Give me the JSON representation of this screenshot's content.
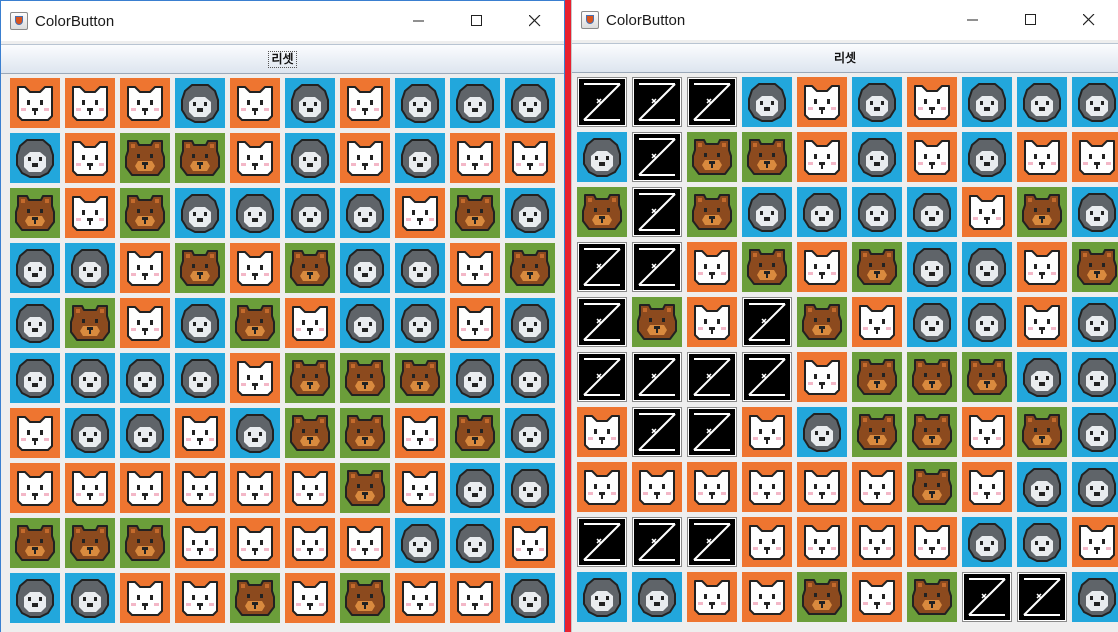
{
  "windows": [
    {
      "id": "left",
      "title": "ColorButton",
      "reset_label": "리셋",
      "grid": [
        [
          "cat",
          "cat",
          "cat",
          "penguin",
          "cat",
          "penguin",
          "cat",
          "penguin",
          "penguin",
          "penguin"
        ],
        [
          "penguin",
          "cat",
          "bear",
          "bear",
          "cat",
          "penguin",
          "cat",
          "penguin",
          "cat",
          "cat"
        ],
        [
          "bear",
          "cat",
          "bear",
          "penguin",
          "penguin",
          "penguin",
          "penguin",
          "cat",
          "bear",
          "penguin"
        ],
        [
          "penguin",
          "penguin",
          "cat",
          "bear",
          "cat",
          "bear",
          "penguin",
          "penguin",
          "cat",
          "bear"
        ],
        [
          "penguin",
          "bear",
          "cat",
          "penguin",
          "bear",
          "cat",
          "penguin",
          "penguin",
          "cat",
          "penguin"
        ],
        [
          "penguin",
          "penguin",
          "penguin",
          "penguin",
          "cat",
          "bear",
          "bear",
          "bear",
          "penguin",
          "penguin"
        ],
        [
          "cat",
          "penguin",
          "penguin",
          "cat",
          "penguin",
          "bear",
          "bear",
          "cat",
          "bear",
          "penguin"
        ],
        [
          "cat",
          "cat",
          "cat",
          "cat",
          "cat",
          "cat",
          "bear",
          "cat",
          "penguin",
          "penguin"
        ],
        [
          "bear",
          "bear",
          "bear",
          "cat",
          "cat",
          "cat",
          "cat",
          "penguin",
          "penguin",
          "cat"
        ],
        [
          "penguin",
          "penguin",
          "cat",
          "cat",
          "bear",
          "cat",
          "bear",
          "cat",
          "cat",
          "penguin"
        ]
      ]
    },
    {
      "id": "right",
      "title": "ColorButton",
      "reset_label": "리셋",
      "grid": [
        [
          "blank",
          "blank",
          "blank",
          "penguin",
          "cat",
          "penguin",
          "cat",
          "penguin",
          "penguin",
          "penguin"
        ],
        [
          "penguin",
          "blank",
          "bear",
          "bear",
          "cat",
          "penguin",
          "cat",
          "penguin",
          "cat",
          "cat"
        ],
        [
          "bear",
          "blank",
          "bear",
          "penguin",
          "penguin",
          "penguin",
          "penguin",
          "cat",
          "bear",
          "penguin"
        ],
        [
          "blank",
          "blank",
          "cat",
          "bear",
          "cat",
          "bear",
          "penguin",
          "penguin",
          "cat",
          "bear"
        ],
        [
          "blank",
          "bear",
          "cat",
          "blank",
          "bear",
          "cat",
          "penguin",
          "penguin",
          "cat",
          "penguin"
        ],
        [
          "blank",
          "blank",
          "blank",
          "blank",
          "cat",
          "bear",
          "bear",
          "bear",
          "penguin",
          "penguin"
        ],
        [
          "cat",
          "blank",
          "blank",
          "cat",
          "penguin",
          "bear",
          "bear",
          "cat",
          "bear",
          "penguin"
        ],
        [
          "cat",
          "cat",
          "cat",
          "cat",
          "cat",
          "cat",
          "bear",
          "cat",
          "penguin",
          "penguin"
        ],
        [
          "blank",
          "blank",
          "blank",
          "cat",
          "cat",
          "cat",
          "cat",
          "penguin",
          "penguin",
          "cat"
        ],
        [
          "penguin",
          "penguin",
          "cat",
          "cat",
          "bear",
          "cat",
          "bear",
          "blank",
          "blank",
          "penguin"
        ]
      ]
    }
  ],
  "icons": {
    "cat": "cat-face-icon",
    "penguin": "penguin-face-icon",
    "bear": "bear-face-icon",
    "blank": "blank-button-icon"
  },
  "colors": {
    "cat_bg": "#ee7530",
    "penguin_bg": "#22a7dc",
    "bear_bg": "#6b9e3a",
    "divider": "#e8202f"
  }
}
